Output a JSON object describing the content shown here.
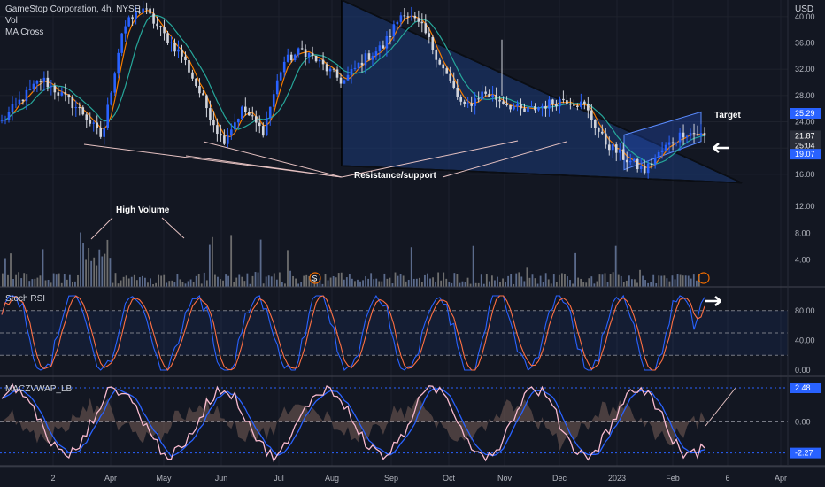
{
  "header": {
    "title": "GameStop Corporation, 4h, NYSE",
    "vol": "Vol",
    "ma": "MA Cross",
    "currency": "USD"
  },
  "panes": {
    "stoch": "Stoch RSI",
    "macd": "MACZVWAP_LB"
  },
  "annotations": {
    "target": "Target",
    "resistance": "Resistance/support",
    "high_volume": "High Volume"
  },
  "colors": {
    "background": "#131722",
    "grid": "#1e222d",
    "up_candle": "#2962ff",
    "down_candle": "#d1d4dc",
    "triangle_fill": "#1c3a78",
    "ma_fast": "#f57c00",
    "ma_slow": "#26a69a",
    "stoch_k": "#2962ff",
    "stoch_d": "#ff7043",
    "macd_line": "#2962ff",
    "signal_line": "#f8bbd0",
    "hist": "#5d4037"
  },
  "chart_data": [
    {
      "type": "candlestick",
      "pane": "price",
      "title": "GameStop Corporation, 4h, NYSE",
      "y_unit": "USD",
      "ylim": [
        14.5,
        42.0
      ],
      "y_ticks": [
        40.0,
        36.0,
        32.0,
        28.0,
        24.0,
        20.0,
        16.0
      ],
      "x_ticks": [
        "2",
        "Apr",
        "May",
        "Jun",
        "Jul",
        "Aug",
        "Sep",
        "Oct",
        "Nov",
        "Dec",
        "2023",
        "Feb",
        "6",
        "Apr"
      ],
      "close_path": [
        [
          "2",
          24.0
        ],
        [
          "Mar",
          27.5
        ],
        [
          "Mar",
          30.5
        ],
        [
          "Mar",
          28.0
        ],
        [
          "Mar",
          25.5
        ],
        [
          "Mar",
          21.5
        ],
        [
          "Apr",
          38.0
        ],
        [
          "Apr",
          41.5
        ],
        [
          "Apr",
          37.5
        ],
        [
          "Apr",
          34.0
        ],
        [
          "May",
          27.5
        ],
        [
          "May",
          21.0
        ],
        [
          "May",
          26.0
        ],
        [
          "Jun",
          22.5
        ],
        [
          "Jun",
          33.0
        ],
        [
          "Jun",
          35.0
        ],
        [
          "Jul",
          32.5
        ],
        [
          "Jul",
          30.0
        ],
        [
          "Jul",
          33.5
        ],
        [
          "Aug",
          35.5
        ],
        [
          "Aug",
          41.0
        ],
        [
          "Aug",
          38.0
        ],
        [
          "Aug",
          32.0
        ],
        [
          "Sep",
          26.0
        ],
        [
          "Sep",
          28.5
        ],
        [
          "Oct",
          27.0
        ],
        [
          "Oct",
          25.5
        ],
        [
          "Nov",
          26.5
        ],
        [
          "Nov",
          27.5
        ],
        [
          "Dec",
          26.5
        ],
        [
          "Dec",
          21.0
        ],
        [
          "Dec",
          18.5
        ],
        [
          "2023",
          16.5
        ],
        [
          "2023",
          20.0
        ],
        [
          "Feb",
          22.5
        ],
        [
          "Feb",
          21.87
        ]
      ],
      "price_labels": [
        {
          "label": "25.29",
          "value": 25.29,
          "color": "#2962ff"
        },
        {
          "label": "21.87",
          "value": 21.87,
          "color": "#131722"
        },
        {
          "label": "25:04",
          "value": 21.0,
          "color": "#131722"
        },
        {
          "label": "19.07",
          "value": 19.07,
          "color": "#2962ff"
        }
      ],
      "series": [
        {
          "name": "MA Cross fast",
          "color": "#f57c00"
        },
        {
          "name": "MA Cross slow",
          "color": "#26a69a"
        }
      ]
    },
    {
      "type": "bar",
      "pane": "volume",
      "title": "Vol",
      "y_ticks": [
        12.0,
        8.0,
        4.0
      ],
      "annotation": "High Volume"
    },
    {
      "type": "line",
      "pane": "stoch",
      "title": "Stoch RSI",
      "ylim": [
        0,
        100
      ],
      "y_ticks": [
        "80.00",
        "40.00",
        "0.00"
      ],
      "levels": [
        80,
        50,
        20
      ]
    },
    {
      "type": "line",
      "pane": "macd",
      "title": "MACZVWAP_LB",
      "y_ticks": [
        "2.48",
        "0.00",
        "-2.27"
      ],
      "ylim": [
        -3.0,
        3.0
      ],
      "last_values": {
        "upper": 2.48,
        "lower": -2.27
      }
    }
  ]
}
